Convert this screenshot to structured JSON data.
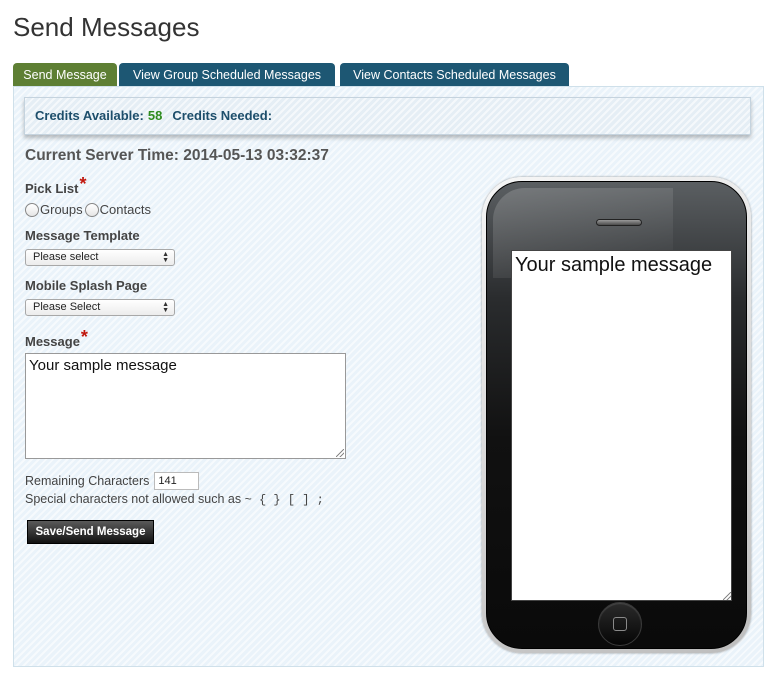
{
  "page": {
    "title": "Send Messages"
  },
  "tabs": [
    {
      "label": "Send Message",
      "active": true
    },
    {
      "label": "View Group Scheduled Messages",
      "active": false
    },
    {
      "label": "View Contacts Scheduled Messages",
      "active": false
    }
  ],
  "credits": {
    "available_label": "Credits Available:",
    "available_value": "58",
    "needed_label": "Credits Needed:",
    "needed_value": ""
  },
  "server_time": {
    "label": "Current Server Time:",
    "value": "2014-05-13 03:32:37"
  },
  "form": {
    "pick_list": {
      "label": "Pick List",
      "required": "*",
      "options": [
        "Groups",
        "Contacts"
      ]
    },
    "message_template": {
      "label": "Message Template",
      "selected": "Please select"
    },
    "splash_page": {
      "label": "Mobile Splash Page",
      "selected": "Please Select"
    },
    "message": {
      "label": "Message",
      "required": "*",
      "value": "Your sample message"
    },
    "remaining": {
      "label": "Remaining Characters",
      "value": "141"
    },
    "special_note": "Special characters not allowed such as",
    "special_chars": "~ { } [ ] ;",
    "submit_label": "Save/Send Message"
  },
  "preview": {
    "text": "Your sample message"
  },
  "colors": {
    "tab_active": "#5e7f34",
    "tab_inactive": "#1d5773",
    "credits_text": "#1d4e6b",
    "credits_value": "#2e8b1e",
    "required": "#c0160c"
  }
}
